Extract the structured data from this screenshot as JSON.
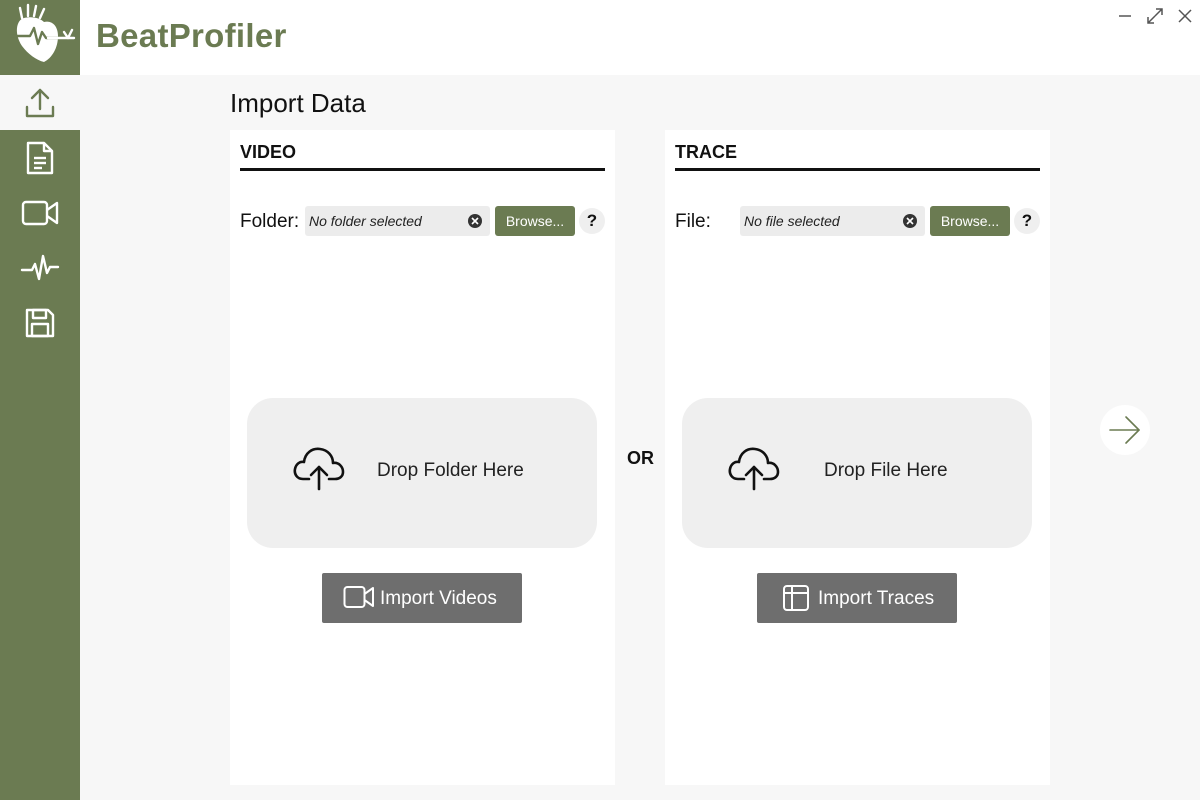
{
  "app": {
    "name": "BeatProfiler"
  },
  "window_controls": {
    "minimize_icon": "minimize-icon",
    "maximize_icon": "maximize-icon",
    "close_icon": "close-icon"
  },
  "sidebar": {
    "items": [
      {
        "id": "import",
        "icon": "upload-icon",
        "active": true
      },
      {
        "id": "document",
        "icon": "document-icon",
        "active": false
      },
      {
        "id": "video",
        "icon": "video-icon",
        "active": false
      },
      {
        "id": "trace",
        "icon": "heartbeat-icon",
        "active": false
      },
      {
        "id": "save",
        "icon": "save-icon",
        "active": false
      }
    ]
  },
  "page": {
    "title": "Import Data"
  },
  "video_panel": {
    "header": "VIDEO",
    "field_label": "Folder:",
    "path_value": "No folder selected",
    "browse_label": "Browse...",
    "help_label": "?",
    "drop_label": "Drop Folder Here",
    "import_label": "Import Videos"
  },
  "separator": {
    "label": "OR"
  },
  "trace_panel": {
    "header": "TRACE",
    "field_label": "File:",
    "path_value": "No file selected",
    "browse_label": "Browse...",
    "help_label": "?",
    "drop_label": "Drop File Here",
    "import_label": "Import Traces"
  },
  "colors": {
    "brand": "#6b7b52",
    "button_gray": "#6e6e6e",
    "background": "#f7f7f7"
  }
}
